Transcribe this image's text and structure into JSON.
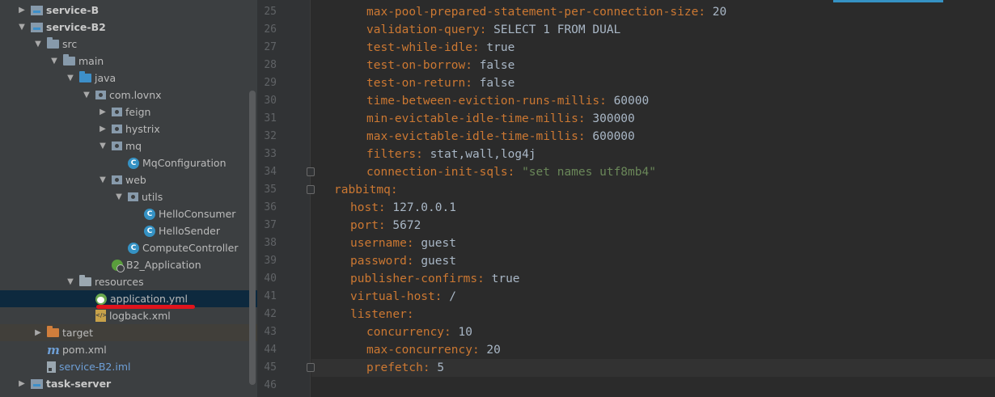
{
  "project_tree": {
    "items": [
      {
        "label": "service-B",
        "depth": 1,
        "arrow": "▶",
        "icon": "module-folder-icon",
        "style": "bold"
      },
      {
        "label": "service-B2",
        "depth": 1,
        "arrow": "▼",
        "icon": "module-folder-icon",
        "style": "bold"
      },
      {
        "label": "src",
        "depth": 2,
        "arrow": "▼",
        "icon": "folder-icon"
      },
      {
        "label": "main",
        "depth": 3,
        "arrow": "▼",
        "icon": "folder-icon"
      },
      {
        "label": "java",
        "depth": 4,
        "arrow": "▼",
        "icon": "source-folder-icon"
      },
      {
        "label": "com.lovnx",
        "depth": 5,
        "arrow": "▼",
        "icon": "package-icon"
      },
      {
        "label": "feign",
        "depth": 6,
        "arrow": "▶",
        "icon": "package-icon"
      },
      {
        "label": "hystrix",
        "depth": 6,
        "arrow": "▶",
        "icon": "package-icon"
      },
      {
        "label": "mq",
        "depth": 6,
        "arrow": "▼",
        "icon": "package-icon"
      },
      {
        "label": "MqConfiguration",
        "depth": 7,
        "arrow": "",
        "icon": "class-icon"
      },
      {
        "label": "web",
        "depth": 6,
        "arrow": "▼",
        "icon": "package-icon"
      },
      {
        "label": "utils",
        "depth": 7,
        "arrow": "▼",
        "icon": "package-icon"
      },
      {
        "label": "HelloConsumer",
        "depth": 8,
        "arrow": "",
        "icon": "class-icon"
      },
      {
        "label": "HelloSender",
        "depth": 8,
        "arrow": "",
        "icon": "class-icon"
      },
      {
        "label": "ComputeController",
        "depth": 7,
        "arrow": "",
        "icon": "class-icon"
      },
      {
        "label": "B2_Application",
        "depth": 6,
        "arrow": "",
        "icon": "spring-boot-class-icon"
      },
      {
        "label": "resources",
        "depth": 4,
        "arrow": "▼",
        "icon": "resources-folder-icon"
      },
      {
        "label": "application.yml",
        "depth": 5,
        "arrow": "",
        "icon": "yml-file-icon",
        "selected": true
      },
      {
        "label": "logback.xml",
        "depth": 5,
        "arrow": "",
        "icon": "xml-file-icon"
      },
      {
        "label": "target",
        "depth": 2,
        "arrow": "▶",
        "icon": "excluded-folder-icon",
        "excluded": true
      },
      {
        "label": "pom.xml",
        "depth": 2,
        "arrow": "",
        "icon": "maven-icon"
      },
      {
        "label": "service-B2.iml",
        "depth": 2,
        "arrow": "",
        "icon": "iml-file-icon",
        "style": "blue"
      },
      {
        "label": "task-server",
        "depth": 1,
        "arrow": "▶",
        "icon": "module-folder-icon",
        "style": "bold"
      }
    ]
  },
  "editor": {
    "lines": [
      {
        "n": "25",
        "indent": 2,
        "key": "max-pool-prepared-statement-per-connection-size",
        "value": "20"
      },
      {
        "n": "26",
        "indent": 2,
        "key": "validation-query",
        "value": "SELECT 1 FROM DUAL"
      },
      {
        "n": "27",
        "indent": 2,
        "key": "test-while-idle",
        "value": "true"
      },
      {
        "n": "28",
        "indent": 2,
        "key": "test-on-borrow",
        "value": "false"
      },
      {
        "n": "29",
        "indent": 2,
        "key": "test-on-return",
        "value": "false"
      },
      {
        "n": "30",
        "indent": 2,
        "key": "time-between-eviction-runs-millis",
        "value": "60000"
      },
      {
        "n": "31",
        "indent": 2,
        "key": "min-evictable-idle-time-millis",
        "value": "300000"
      },
      {
        "n": "32",
        "indent": 2,
        "key": "max-evictable-idle-time-millis",
        "value": "600000"
      },
      {
        "n": "33",
        "indent": 2,
        "key": "filters",
        "value": "stat,wall,log4j"
      },
      {
        "n": "34",
        "indent": 2,
        "key": "connection-init-sqls",
        "value": "\"set names utf8mb4\"",
        "string": true,
        "fold": true
      },
      {
        "n": "35",
        "indent": 0,
        "key": "rabbitmq",
        "value": "",
        "fold": true
      },
      {
        "n": "36",
        "indent": 1,
        "key": "host",
        "value": "127.0.0.1"
      },
      {
        "n": "37",
        "indent": 1,
        "key": "port",
        "value": "5672"
      },
      {
        "n": "38",
        "indent": 1,
        "key": "username",
        "value": "guest"
      },
      {
        "n": "39",
        "indent": 1,
        "key": "password",
        "value": "guest"
      },
      {
        "n": "40",
        "indent": 1,
        "key": "publisher-confirms",
        "value": "true"
      },
      {
        "n": "41",
        "indent": 1,
        "key": "virtual-host",
        "value": "/"
      },
      {
        "n": "42",
        "indent": 1,
        "key": "listener",
        "value": ""
      },
      {
        "n": "43",
        "indent": 2,
        "key": "concurrency",
        "value": "10"
      },
      {
        "n": "44",
        "indent": 2,
        "key": "max-concurrency",
        "value": "20"
      },
      {
        "n": "45",
        "indent": 2,
        "key": "prefetch",
        "value": "5",
        "fold": true,
        "caret": true
      },
      {
        "n": "46",
        "indent": 0,
        "key": "",
        "value": ""
      }
    ]
  },
  "colors": {
    "key": "#cc7832",
    "value": "#a9b7c6",
    "string": "#6a8759",
    "selection": "#0d293e",
    "annotation_underline": "#e0141c"
  }
}
